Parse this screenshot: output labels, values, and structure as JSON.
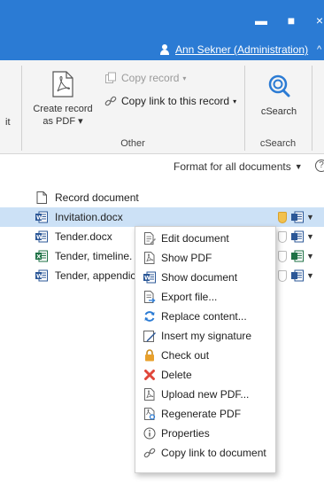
{
  "window": {
    "minimize_glyph": "▬",
    "maximize_glyph": "■",
    "close_glyph": "×"
  },
  "user": {
    "name": "Ann Sekner (Administration)"
  },
  "ribbon": {
    "create_pdf": {
      "line1": "Create record",
      "line2": "as PDF ▾"
    },
    "copy_record": "Copy record",
    "copy_link_record": "Copy link to this record",
    "group_other": "Other",
    "csearch": "cSearch",
    "group_csearch": "cSearch",
    "cut_off_text": "it"
  },
  "format": {
    "label": "Format for all documents",
    "help": "?"
  },
  "documents": [
    {
      "label": "Record document",
      "icon": "blank-document-icon",
      "selected": false
    },
    {
      "label": "Invitation.docx",
      "icon": "word-icon",
      "selected": true
    },
    {
      "label": "Tender.docx",
      "icon": "word-icon",
      "selected": false
    },
    {
      "label": "Tender, timeline.",
      "icon": "excel-icon",
      "selected": false
    },
    {
      "label": "Tender, appendic",
      "icon": "word-icon",
      "selected": false
    }
  ],
  "context_menu": {
    "items": [
      {
        "label": "Edit document",
        "icon": "edit-document-icon"
      },
      {
        "label": "Show PDF",
        "icon": "pdf-icon"
      },
      {
        "label": "Show document",
        "icon": "word-icon"
      },
      {
        "label": "Export file...",
        "icon": "export-icon"
      },
      {
        "label": "Replace content...",
        "icon": "replace-icon"
      },
      {
        "label": "Insert my signature",
        "icon": "signature-icon"
      },
      {
        "label": "Check out",
        "icon": "lock-icon"
      },
      {
        "label": "Delete",
        "icon": "delete-icon"
      },
      {
        "label": "Upload new PDF...",
        "icon": "upload-pdf-icon"
      },
      {
        "label": "Regenerate PDF",
        "icon": "regenerate-pdf-icon"
      },
      {
        "label": "Properties",
        "icon": "info-icon"
      },
      {
        "label": "Copy link to document",
        "icon": "link-icon"
      }
    ]
  },
  "colors": {
    "titlebar": "#2b7bd4",
    "selection": "#cce1f6",
    "word_blue": "#2b5797",
    "excel_green": "#1e7145",
    "delete_red": "#e0463a",
    "lock_orange": "#e8a02b"
  }
}
